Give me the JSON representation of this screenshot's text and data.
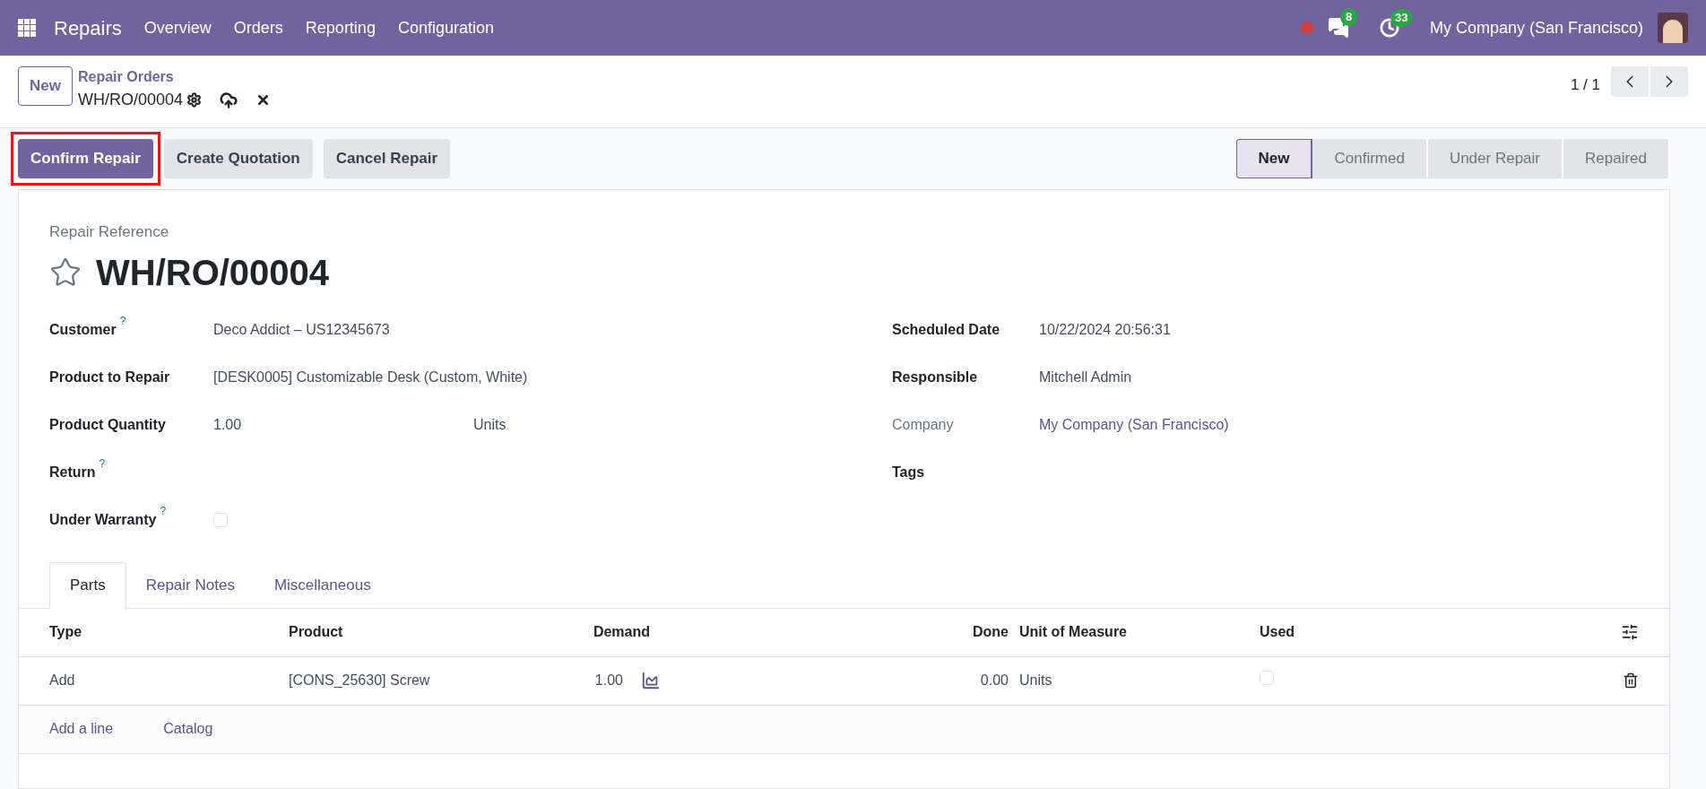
{
  "topbar": {
    "app": "Repairs",
    "menu": [
      "Overview",
      "Orders",
      "Reporting",
      "Configuration"
    ],
    "messages_badge": "8",
    "activities_badge": "33",
    "company": "My Company (San Francisco)"
  },
  "control_panel": {
    "new_button": "New",
    "breadcrumb": "Repair Orders",
    "record": "WH/RO/00004",
    "pager": "1 / 1"
  },
  "actions": [
    {
      "label": "Confirm Repair",
      "kind": "primary",
      "highlighted": true
    },
    {
      "label": "Create Quotation",
      "kind": "secondary",
      "highlighted": false
    },
    {
      "label": "Cancel Repair",
      "kind": "secondary",
      "highlighted": false
    }
  ],
  "stages": [
    {
      "label": "New",
      "selected": true
    },
    {
      "label": "Confirmed",
      "selected": false
    },
    {
      "label": "Under Repair",
      "selected": false
    },
    {
      "label": "Repaired",
      "selected": false
    }
  ],
  "form": {
    "reference_label": "Repair Reference",
    "title": "WH/RO/00004",
    "left_fields": [
      {
        "label": "Customer",
        "help": "?",
        "kind": "text",
        "value": "Deco Addict – US12345673"
      },
      {
        "label": "Product to Repair",
        "kind": "text",
        "value": "[DESK0005] Customizable Desk (Custom, White)"
      },
      {
        "label": "Product Quantity",
        "kind": "quantity",
        "value": "1.00",
        "unit": "Units"
      },
      {
        "label": "Return",
        "help": "?",
        "kind": "text"
      },
      {
        "label": "Under Warranty",
        "help": "?",
        "kind": "checkbox",
        "checked": false
      }
    ],
    "right_fields": [
      {
        "label": "Scheduled Date",
        "kind": "text",
        "value": "10/22/2024 20:56:31"
      },
      {
        "label": "Responsible",
        "kind": "text",
        "value": "Mitchell Admin"
      },
      {
        "label": "Company",
        "kind": "link",
        "readonly": true,
        "value": "My Company (San Francisco)"
      },
      {
        "label": "Tags",
        "kind": "text"
      }
    ]
  },
  "tabs": [
    {
      "label": "Parts",
      "selected": true
    },
    {
      "label": "Repair Notes",
      "selected": false
    },
    {
      "label": "Miscellaneous",
      "selected": false
    }
  ],
  "table": {
    "columns": [
      "Type",
      "Product",
      "Demand",
      "Done",
      "Unit of Measure",
      "Used"
    ],
    "rows": [
      {
        "type": "Add",
        "product": "[CONS_25630] Screw",
        "demand": "1.00",
        "done": "0.00",
        "uom": "Units",
        "used": false
      }
    ],
    "footer_links": [
      "Add a line",
      "Catalog"
    ]
  }
}
